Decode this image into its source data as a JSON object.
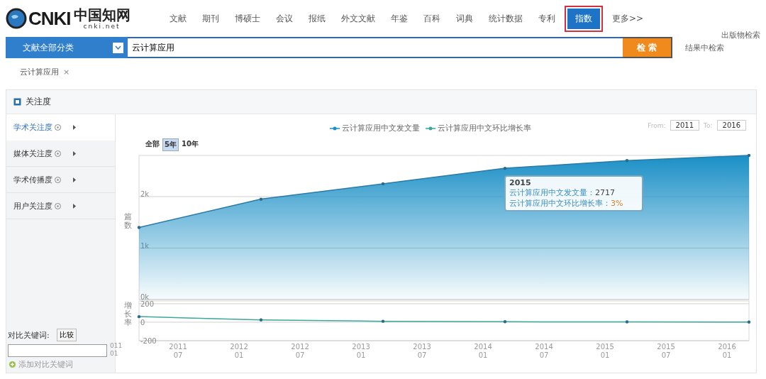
{
  "logo": {
    "mark": "CNKI",
    "name": "中国知网",
    "domain": "cnki.net"
  },
  "nav": [
    {
      "label": "文献",
      "selected": false
    },
    {
      "label": "期刊",
      "selected": false
    },
    {
      "label": "博硕士",
      "selected": false
    },
    {
      "label": "会议",
      "selected": false
    },
    {
      "label": "报纸",
      "selected": false
    },
    {
      "label": "外文文献",
      "selected": false
    },
    {
      "label": "年鉴",
      "selected": false
    },
    {
      "label": "百科",
      "selected": false
    },
    {
      "label": "词典",
      "selected": false
    },
    {
      "label": "统计数据",
      "selected": false
    },
    {
      "label": "专利",
      "selected": false
    },
    {
      "label": "指数",
      "selected": true
    },
    {
      "label": "更多>>",
      "selected": false
    }
  ],
  "search": {
    "category": "文献全部分类",
    "value": "云计算应用",
    "button": "检 索",
    "links": [
      "出版物检索",
      "结果中检索"
    ]
  },
  "chip": {
    "label": "云计算应用",
    "close": "×"
  },
  "panel": {
    "title": "关注度",
    "sidebar": [
      {
        "label": "学术关注度",
        "selected": true
      },
      {
        "label": "媒体关注度",
        "selected": false
      },
      {
        "label": "学术传播度",
        "selected": false
      },
      {
        "label": "用户关注度",
        "selected": false
      }
    ],
    "compare": {
      "label": "对比关键词:",
      "button": "比较",
      "add": "添加对比关键词"
    },
    "ranges": [
      {
        "label": "全部",
        "selected": false
      },
      {
        "label": "5年",
        "selected": true
      },
      {
        "label": "10年",
        "selected": false
      }
    ],
    "from_label": "From:",
    "from": "2011",
    "to_label": "To:",
    "to": "2016",
    "tooltip": {
      "title": "2015",
      "lines": [
        {
          "label": "云计算应用中文发文量：",
          "value": "2717"
        },
        {
          "label": "云计算应用中文环比增长率：",
          "value": "3%"
        }
      ]
    },
    "clipped_tick": "011\n01",
    "chart": {
      "chart_data": {
        "type": "area",
        "ylabel": "篇数",
        "categories": [
          null,
          null,
          null,
          null,
          null,
          null
        ],
        "ylim": [
          0,
          2800
        ],
        "yticks": [
          {
            "value": 0,
            "label": "0k"
          },
          {
            "value": 1000,
            "label": "1k"
          },
          {
            "value": 2000,
            "label": "2k"
          }
        ],
        "series": [
          {
            "name": "云计算应用中文发文量",
            "color": "#1a8fc6",
            "values": [
              1400,
              1950,
              2250,
              2550,
              2700,
              2800
            ]
          }
        ]
      }
    },
    "x_axis_labels": [
      "2011\n07",
      "2012\n01",
      "2012\n07",
      "2013\n01",
      "2013\n07",
      "2014\n01",
      "2014\n07",
      "2015\n01",
      "2015\n07",
      "2016\n01"
    ],
    "growth_chart": {
      "chart_data": {
        "type": "line",
        "ylabel": "增长率",
        "categories": [
          null,
          null,
          null,
          null,
          null,
          null
        ],
        "ylim": [
          -200,
          230
        ],
        "yticks": [
          -200,
          0,
          200
        ],
        "series": [
          {
            "name": "云计算应用中文环比增长率",
            "color": "#3aa89a",
            "values": [
              60,
              25,
              10,
              5,
              3,
              2
            ]
          }
        ]
      }
    }
  }
}
